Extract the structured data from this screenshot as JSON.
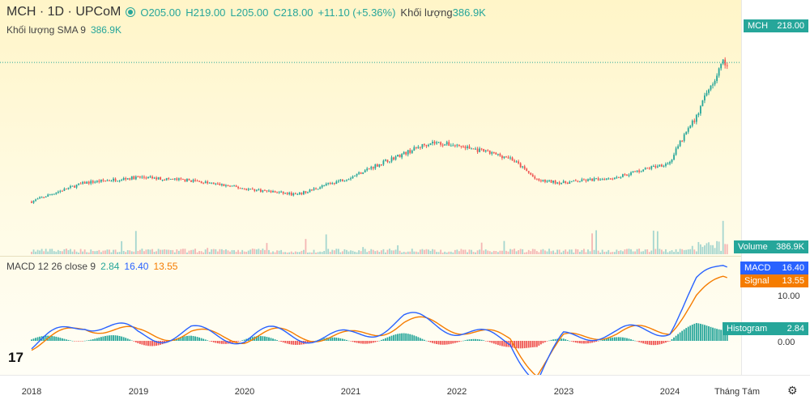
{
  "header": {
    "symbol": "MCH · 1D · UPCoM",
    "open": "O205.00",
    "high": "H219.00",
    "low": "L205.00",
    "close": "C218.00",
    "change": "+11.10 (+5.36%)",
    "volume_label": "Khối lượng",
    "volume_value": "386.9K"
  },
  "sma_legend": {
    "label": "Khối lượng SMA 9",
    "value": "386.9K"
  },
  "macd_legend": {
    "label": "MACD 12 26 close 9",
    "histogram": "2.84",
    "macd": "16.40",
    "signal": "13.55"
  },
  "price_tag": {
    "label": "MCH",
    "value": "218.00"
  },
  "volume_tag": {
    "label": "Volume",
    "value": "386.9K"
  },
  "macd_tag": {
    "label": "MACD",
    "value": "16.40"
  },
  "signal_tag": {
    "label": "Signal",
    "value": "13.55"
  },
  "histogram_tag": {
    "label": "Histogram",
    "value": "2.84"
  },
  "macd_axis": {
    "upper": "10.00",
    "zero": "0.00"
  },
  "time_axis": {
    "years": [
      "2018",
      "2019",
      "2020",
      "2021",
      "2022",
      "2023",
      "2024"
    ],
    "month_label": "Tháng Tám"
  },
  "colors": {
    "up": "#26a69a",
    "down": "#ef5350",
    "macd": "#2962ff",
    "signal": "#f57c00",
    "background": "#fff8d6"
  },
  "chart_data": [
    {
      "type": "candlestick",
      "symbol": "MCH",
      "x": [
        "2018-01",
        "2018-07",
        "2019-01",
        "2019-07",
        "2020-01",
        "2020-07",
        "2021-01",
        "2021-07",
        "2021-10",
        "2022-01",
        "2022-07",
        "2022-10",
        "2023-01",
        "2023-07",
        "2024-01",
        "2024-04",
        "2024-07"
      ],
      "close": [
        25,
        40,
        45,
        42,
        35,
        30,
        45,
        70,
        84,
        80,
        65,
        42,
        40,
        45,
        60,
        120,
        218
      ],
      "last": {
        "open": 205.0,
        "high": 219.0,
        "low": 205.0,
        "close": 218.0
      },
      "last_volume": "386.9K"
    },
    {
      "type": "line",
      "name": "MACD 12 26 close 9",
      "x": [
        "2018-01",
        "2018-07",
        "2019-01",
        "2019-07",
        "2020-01",
        "2020-07",
        "2021-01",
        "2021-07",
        "2022-01",
        "2022-07",
        "2022-10",
        "2023-01",
        "2023-07",
        "2024-01",
        "2024-04",
        "2024-07"
      ],
      "series": [
        {
          "name": "MACD",
          "values": [
            0,
            3,
            1,
            3,
            0,
            1,
            2,
            4,
            2,
            1,
            -8,
            0,
            1,
            4,
            13,
            16.4
          ]
        },
        {
          "name": "Signal",
          "values": [
            0,
            2.5,
            1,
            2.6,
            0.3,
            0.8,
            1.8,
            3.6,
            2.2,
            1.2,
            -6,
            0,
            1,
            3.5,
            10,
            13.55
          ]
        }
      ],
      "histogram_last": 2.84,
      "ylabels": [
        "10.00",
        "0.00"
      ]
    }
  ]
}
